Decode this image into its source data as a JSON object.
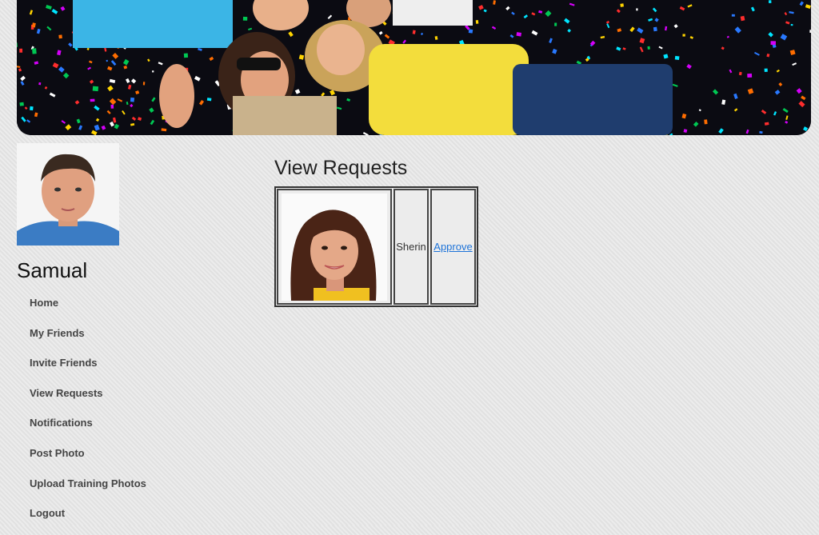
{
  "user": {
    "name": "Samual"
  },
  "nav": {
    "items": [
      {
        "label": "Home"
      },
      {
        "label": "My Friends"
      },
      {
        "label": "Invite Friends"
      },
      {
        "label": "View Requests"
      },
      {
        "label": "Notifications"
      },
      {
        "label": "Post Photo"
      },
      {
        "label": "Upload Training Photos"
      },
      {
        "label": "Logout"
      }
    ]
  },
  "main": {
    "title": "View Requests",
    "requests": [
      {
        "name": "Sherin",
        "action_label": "Approve"
      }
    ]
  },
  "colors": {
    "link": "#1e73d8",
    "background": "#e6e6e6",
    "text": "#444444"
  }
}
